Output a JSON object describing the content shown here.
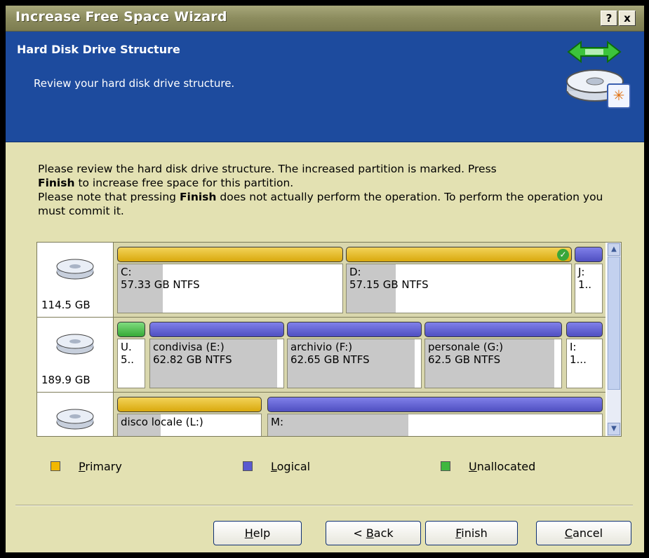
{
  "window": {
    "title": "Increase Free Space Wizard",
    "help_button": "?",
    "close_button": "x"
  },
  "header": {
    "title": "Hard Disk Drive Structure",
    "subtitle": "Review your hard disk drive structure."
  },
  "description": {
    "line1_pre": "Please review the hard disk drive structure. The increased partition is marked. Press",
    "line1_bold": "Finish",
    "line1_post": " to increase free space for this partition.",
    "line2_pre": "Please note that pressing ",
    "line2_bold": "Finish",
    "line2_post": " does not actually perform the operation. To perform the operation you must commit it."
  },
  "disks": [
    {
      "size": "114.5 GB",
      "partitions": [
        {
          "type": "primary",
          "name": "C:",
          "info": "57.33 GB  NTFS",
          "used_fraction": 0.2
        },
        {
          "type": "primary",
          "name": "D:",
          "info": "57.15 GB  NTFS",
          "used_fraction": 0.22,
          "marked": true
        },
        {
          "type": "logical",
          "name": "J:",
          "info": "1..",
          "used_fraction": 0.0
        }
      ]
    },
    {
      "size": "189.9 GB",
      "partitions": [
        {
          "type": "unallocated",
          "name": "U.",
          "info": "5..",
          "used_fraction": 0.0
        },
        {
          "type": "logical",
          "name": "condivisa (E:)",
          "info": "62.82 GB  NTFS",
          "used_fraction": 0.95
        },
        {
          "type": "logical",
          "name": "archivio (F:)",
          "info": "62.65 GB  NTFS",
          "used_fraction": 0.95
        },
        {
          "type": "logical",
          "name": "personale (G:)",
          "info": "62.5 GB  NTFS",
          "used_fraction": 0.95
        },
        {
          "type": "logical",
          "name": "I:",
          "info": "1...",
          "used_fraction": 0.0
        }
      ]
    },
    {
      "size": "",
      "partitions": [
        {
          "type": "primary",
          "name": "disco locale (L:)",
          "info": "",
          "used_fraction": 0.3
        },
        {
          "type": "logical",
          "name": "M:",
          "info": "",
          "used_fraction": 0.42
        }
      ]
    }
  ],
  "legend": {
    "primary_key": "P",
    "primary_rest": "rimary",
    "logical_key": "L",
    "logical_rest": "ogical",
    "unallocated_key": "U",
    "unallocated_rest": "nallocated",
    "colors": {
      "primary": "#f2b800",
      "logical": "#5a5ad0",
      "unallocated": "#3fb73f"
    }
  },
  "buttons": {
    "help_key": "H",
    "help_rest": "elp",
    "back_pre": "< ",
    "back_key": "B",
    "back_rest": "ack",
    "finish_key": "F",
    "finish_rest": "inish",
    "cancel_key": "C",
    "cancel_rest": "ancel"
  }
}
